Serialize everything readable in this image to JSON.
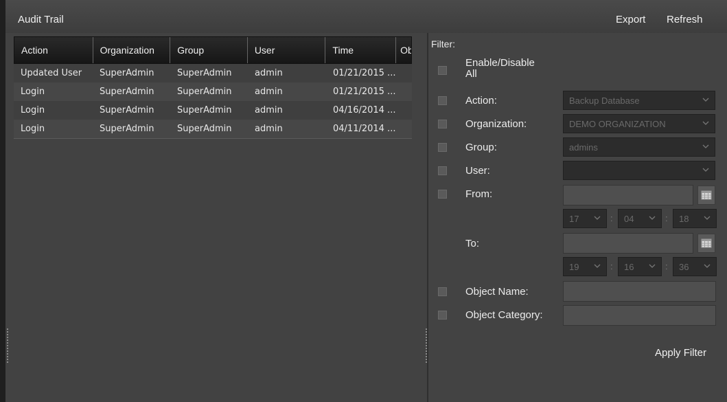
{
  "toolbar": {
    "title": "Audit Trail",
    "export_label": "Export",
    "refresh_label": "Refresh"
  },
  "grid": {
    "columns": [
      "Action",
      "Organization",
      "Group",
      "User",
      "Time",
      "Ob"
    ],
    "rows": [
      [
        "Updated User",
        "SuperAdmin",
        "SuperAdmin",
        "admin",
        "01/21/2015 ..."
      ],
      [
        "Login",
        "SuperAdmin",
        "SuperAdmin",
        "admin",
        "01/21/2015 ..."
      ],
      [
        "Login",
        "SuperAdmin",
        "SuperAdmin",
        "admin",
        "04/16/2014 ..."
      ],
      [
        "Login",
        "SuperAdmin",
        "SuperAdmin",
        "admin",
        "04/11/2014 ..."
      ]
    ]
  },
  "filter": {
    "title": "Filter:",
    "enable_all_line1": "Enable/Disable",
    "enable_all_line2": "All",
    "action_label": "Action:",
    "action_value": "Backup Database",
    "organization_label": "Organization:",
    "organization_value": "DEMO ORGANIZATION",
    "group_label": "Group:",
    "group_value": "admins",
    "user_label": "User:",
    "user_value": "",
    "from_label": "From:",
    "from_hour": "17",
    "from_minute": "04",
    "from_second": "18",
    "to_label": "To:",
    "to_hour": "19",
    "to_minute": "16",
    "to_second": "36",
    "time_separator": ":",
    "object_name_label": "Object Name:",
    "object_category_label": "Object Category:",
    "apply_label": "Apply Filter"
  },
  "icons": [
    "chevron-down-icon",
    "calendar-icon",
    "splitter-grip-icon"
  ],
  "colors": {
    "background": "#424242",
    "header_dark": "#1a1a1a",
    "input_dark": "#2c2c2c"
  }
}
